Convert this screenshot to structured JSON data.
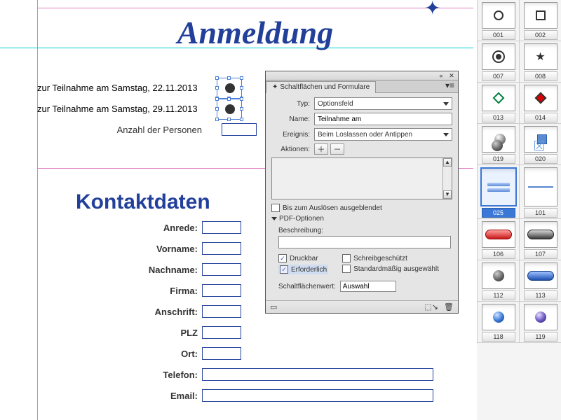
{
  "title": "Anmeldung",
  "participation": {
    "line1": "zur Teilnahme am Samstag, 22.11.2013",
    "line2": "zur Teilnahme am Samstag, 29.11.2013",
    "persons_label": "Anzahl der Personen"
  },
  "contact": {
    "heading": "Kontaktdaten",
    "anrede": "Anrede:",
    "vorname": "Vorname:",
    "nachname": "Nachname:",
    "firma": "Firma:",
    "anschrift": "Anschrift:",
    "plz": "PLZ",
    "ort": "Ort:",
    "telefon": "Telefon:",
    "email": "Email:"
  },
  "panel": {
    "tab": "Schaltflächen und Formulare",
    "typ_label": "Typ:",
    "typ_value": "Optionsfeld",
    "name_label": "Name:",
    "name_value": "Teilnahme am",
    "ereignis_label": "Ereignis:",
    "ereignis_value": "Beim Loslassen oder Antippen",
    "aktionen_label": "Aktionen:",
    "hidden_until": "Bis zum Auslösen ausgeblendet",
    "pdf_options": "PDF-Optionen",
    "beschreibung": "Beschreibung:",
    "druckbar": "Druckbar",
    "erforderlich": "Erforderlich",
    "schreibgeschuetzt": "Schreibgeschützt",
    "standard": "Standardmäßig ausgewählt",
    "wert_label": "Schaltflächenwert:",
    "wert_value": "Auswahl"
  },
  "library": [
    {
      "a": "001",
      "b": "002"
    },
    {
      "a": "007",
      "b": "008"
    },
    {
      "a": "013",
      "b": "014"
    },
    {
      "a": "019",
      "b": "020"
    },
    {
      "a": "025",
      "b": "101"
    },
    {
      "a": "106",
      "b": "107"
    },
    {
      "a": "112",
      "b": "113"
    },
    {
      "a": "118",
      "b": "119"
    }
  ]
}
